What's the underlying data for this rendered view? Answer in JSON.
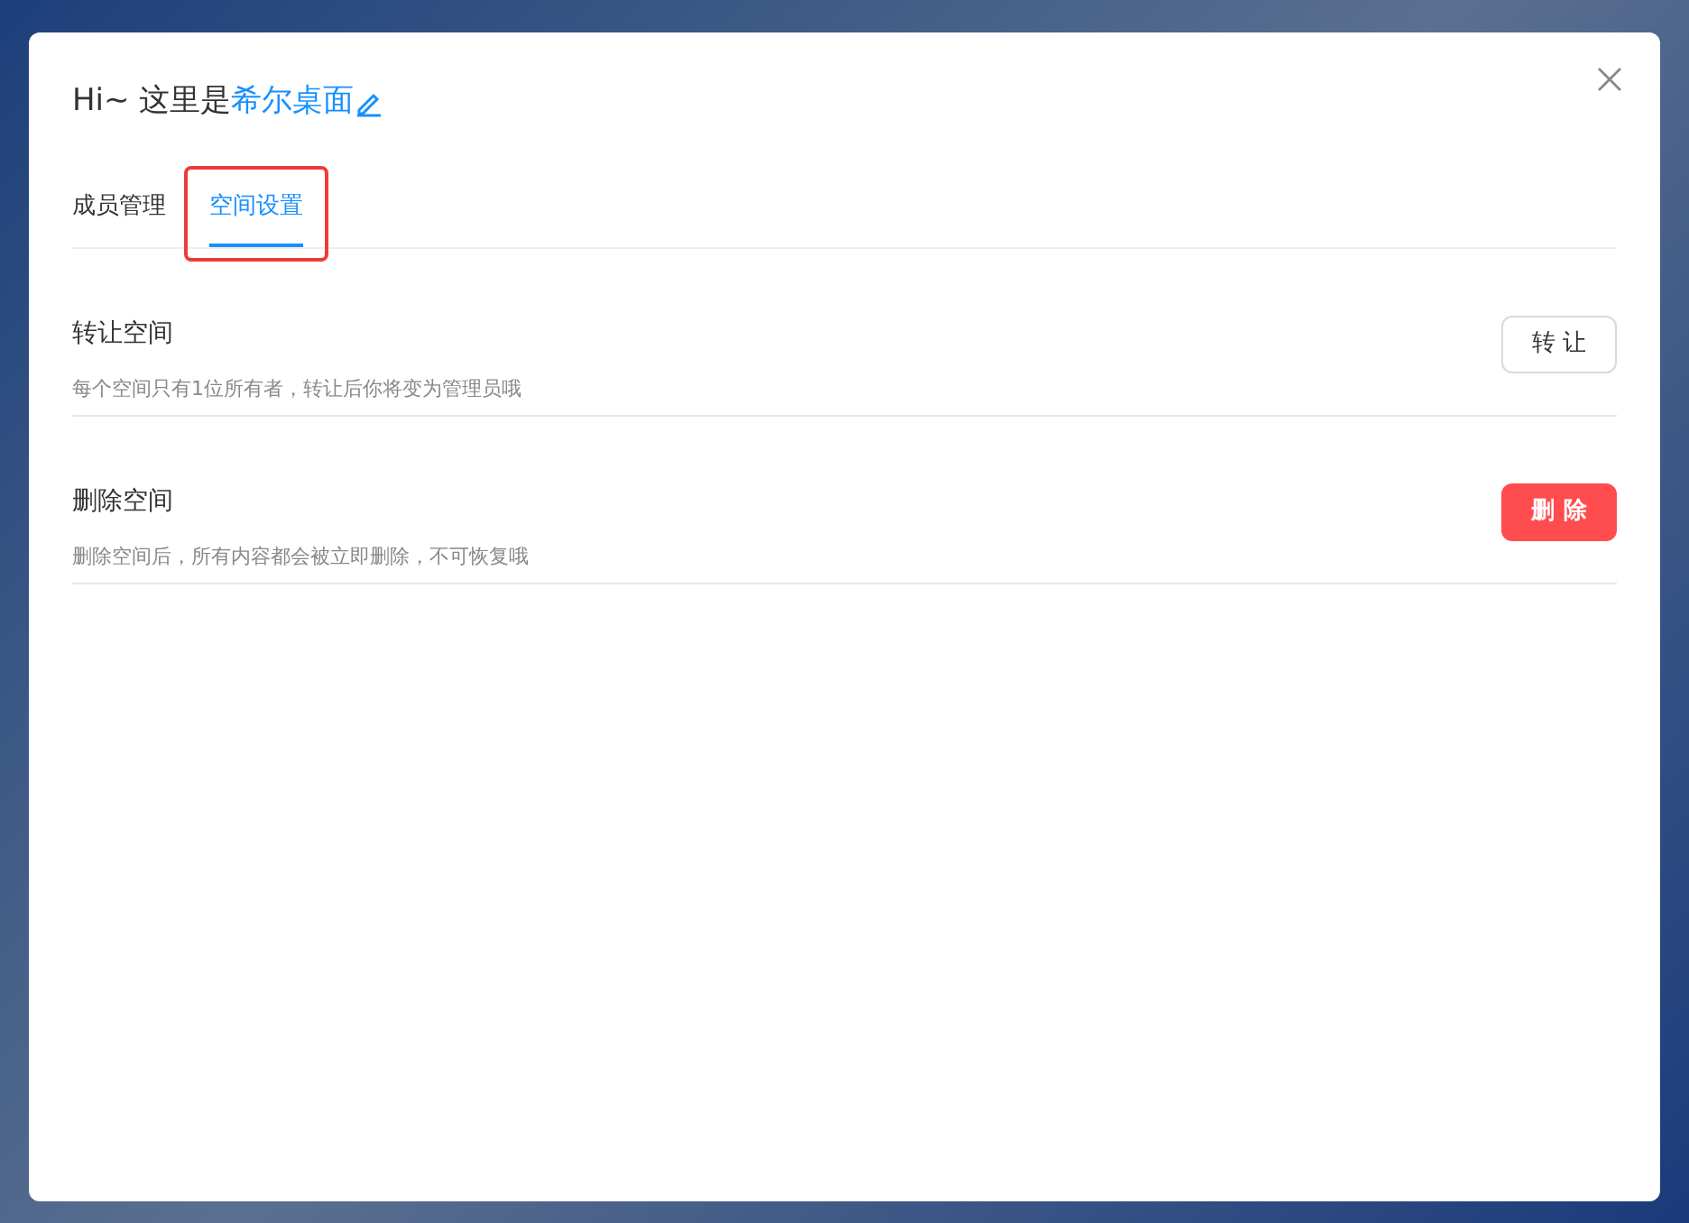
{
  "dialog": {
    "title_prefix": "Hi~ 这里是",
    "space_name": "希尔桌面"
  },
  "tabs": [
    {
      "label": "成员管理",
      "selected": false,
      "highlighted": false
    },
    {
      "label": "空间设置",
      "selected": true,
      "highlighted": true
    }
  ],
  "settings": [
    {
      "title": "转让空间",
      "description": "每个空间只有1位所有者，转让后你将变为管理员哦",
      "button": {
        "label": "转 让",
        "kind": "default"
      }
    },
    {
      "title": "删除空间",
      "description": "删除空间后，所有内容都会被立即删除，不可恢复哦",
      "button": {
        "label": "删 除",
        "kind": "danger"
      }
    }
  ]
}
